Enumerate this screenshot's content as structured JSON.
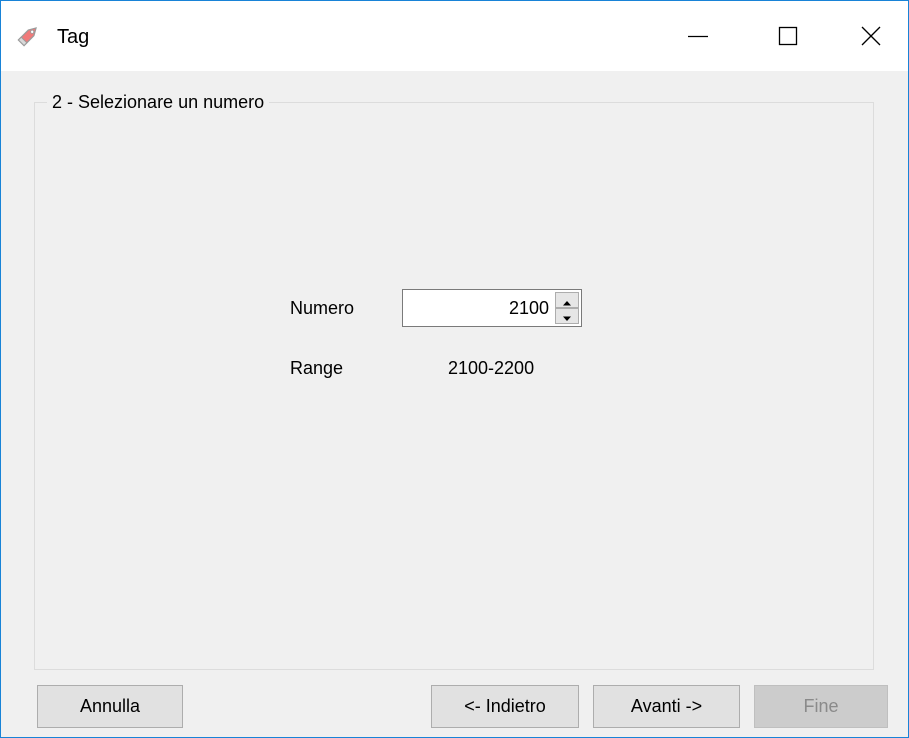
{
  "window": {
    "title": "Tag",
    "icon": "tag-icon",
    "controls": [
      "minimize-icon",
      "maximize-icon",
      "close-icon"
    ]
  },
  "group": {
    "legend": "2 - Selezionare un numero"
  },
  "form": {
    "numero_label": "Numero",
    "numero_value": "2100",
    "range_label": "Range",
    "range_value": "2100-2200"
  },
  "buttons": {
    "annulla": "Annulla",
    "indietro": "<- Indietro",
    "avanti": "Avanti ->",
    "fine": "Fine",
    "fine_enabled": false
  },
  "colors": {
    "window_border": "#1883d7",
    "client_bg": "#f0f0f0",
    "button_bg": "#e1e1e1",
    "disabled_text": "#8a8a8a"
  }
}
